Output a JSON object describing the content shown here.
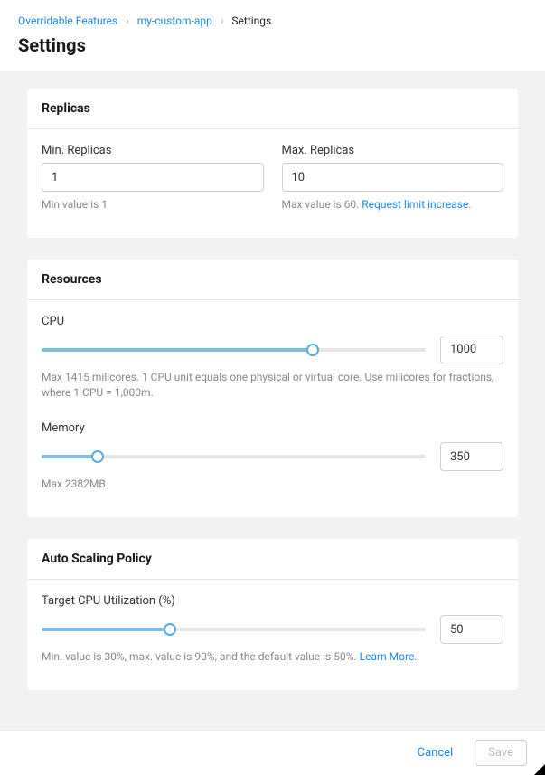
{
  "breadcrumb": {
    "items": [
      "Overridable Features",
      "my-custom-app",
      "Settings"
    ]
  },
  "page_title": "Settings",
  "cards": {
    "replicas": {
      "title": "Replicas",
      "min": {
        "label": "Min. Replicas",
        "value": "1",
        "helper": "Min value is 1"
      },
      "max": {
        "label": "Max. Replicas",
        "value": "10",
        "helper_prefix": "Max value is 60. ",
        "link": "Request limit increase",
        "helper_suffix": "."
      }
    },
    "resources": {
      "title": "Resources",
      "cpu": {
        "label": "CPU",
        "value": "1000",
        "max": 1415,
        "fill_pct": 70.7,
        "helper": "Max 1415 milicores. 1 CPU unit equals one physical or virtual core. Use milicores for fractions, where 1 CPU = 1,000m."
      },
      "memory": {
        "label": "Memory",
        "value": "350",
        "max": 2382,
        "fill_pct": 14.7,
        "helper": "Max 2382MB"
      }
    },
    "autoscaling": {
      "title": "Auto Scaling Policy",
      "target": {
        "label": "Target CPU Utilization (%)",
        "value": "50",
        "min": 30,
        "max": 90,
        "fill_pct": 33.3,
        "helper_text": "Min. value is 30%, max. value is 90%, and the default value is 50%. ",
        "link": "Learn More."
      }
    }
  },
  "footer": {
    "cancel": "Cancel",
    "save": "Save"
  }
}
